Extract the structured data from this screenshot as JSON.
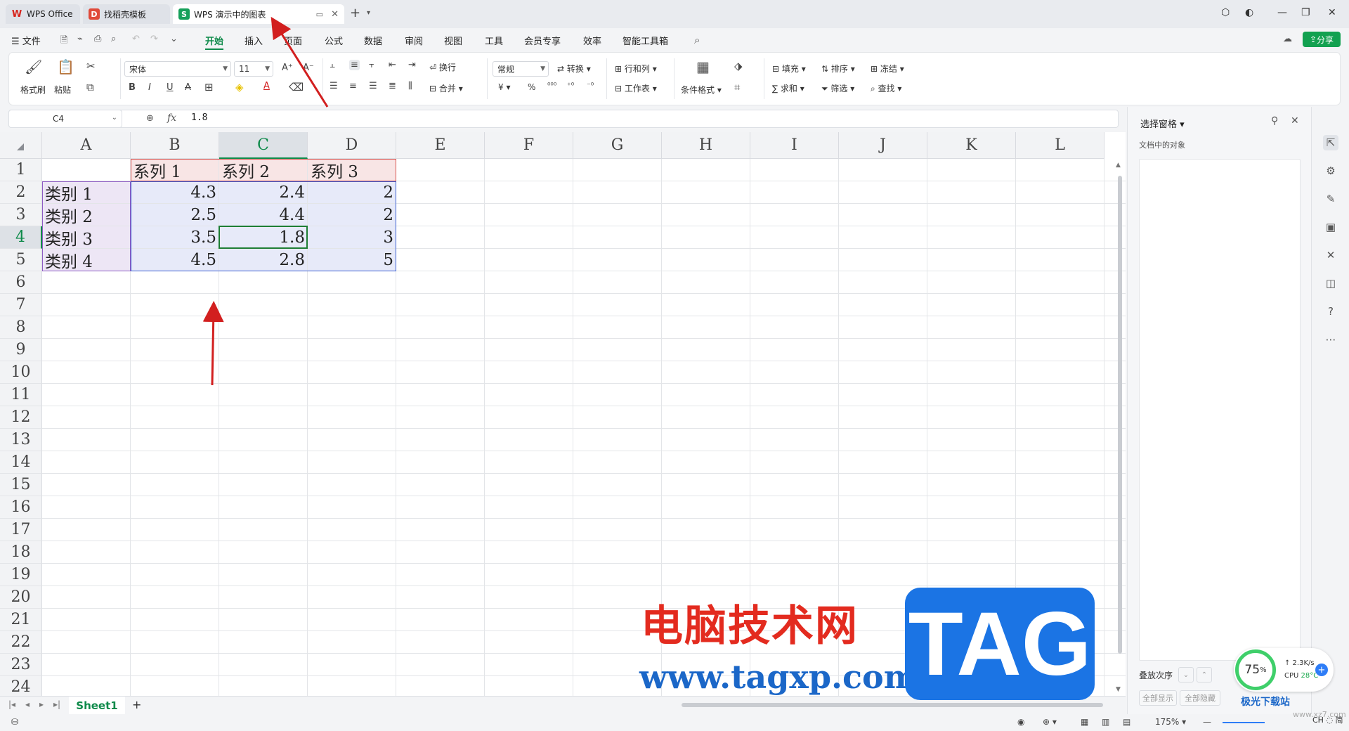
{
  "tabs": [
    {
      "label": "WPS Office"
    },
    {
      "label": "找稻壳模板"
    },
    {
      "label": "WPS 演示中的图表"
    }
  ],
  "menu": {
    "file": "文件",
    "items": [
      "开始",
      "插入",
      "页面",
      "公式",
      "数据",
      "审阅",
      "视图",
      "工具",
      "会员专享",
      "效率",
      "智能工具箱"
    ],
    "share": "分享"
  },
  "ribbon": {
    "format_painter": "格式刷",
    "paste": "粘贴",
    "font_name": "宋体",
    "font_size": "11",
    "wrap": "换行",
    "merge": "合并",
    "number_format": "常规",
    "convert": "转换",
    "row_col": "行和列",
    "worksheet": "工作表",
    "cond_format": "条件格式",
    "fill": "填充",
    "sort": "排序",
    "freeze": "冻结",
    "sum": "求和",
    "filter": "筛选",
    "find": "查找",
    "yen": "¥",
    "percent": "%"
  },
  "formula_bar": {
    "cell_ref": "C4",
    "fx": "fx",
    "value": "1.8"
  },
  "sheet": {
    "columns": [
      "A",
      "B",
      "C",
      "D",
      "E",
      "F",
      "G",
      "H",
      "I",
      "J",
      "K",
      "L"
    ],
    "rows": [
      "1",
      "2",
      "3",
      "4",
      "5",
      "6",
      "7",
      "8",
      "9",
      "10",
      "11",
      "12",
      "13",
      "14",
      "15",
      "16",
      "17",
      "18",
      "19",
      "20",
      "21",
      "22",
      "23",
      "24"
    ],
    "selected_col": "C",
    "selected_row": "4",
    "header_row": [
      "",
      "系列 1",
      "系列 2",
      "系列 3"
    ],
    "data": [
      [
        "类别 1",
        "4.3",
        "2.4",
        "2"
      ],
      [
        "类别 2",
        "2.5",
        "4.4",
        "2"
      ],
      [
        "类别 3",
        "3.5",
        "1.8",
        "3"
      ],
      [
        "类别 4",
        "4.5",
        "2.8",
        "5"
      ]
    ],
    "sheet_tab": "Sheet1"
  },
  "right_pane": {
    "title": "选择窗格",
    "subtitle": "文档中的对象",
    "order_label": "叠放次序",
    "show_all": "全部显示",
    "hide_all": "全部隐藏"
  },
  "status": {
    "zoom": "175%"
  },
  "widget": {
    "percent": "75",
    "percent_unit": "%",
    "speed": "↑ 2.3K/s",
    "cpu_label": "CPU",
    "cpu_temp": "28°C"
  },
  "watermark": {
    "cn": "电脑技术网",
    "url": "www.tagxp.com",
    "tag": "TAG",
    "corner": "极光下载站",
    "corner2": "www.xz7.com",
    "ch": "CH ◌ 简"
  },
  "colors": {
    "accent": "#0e8a4a",
    "annotation_arrow": "#d21f1f"
  }
}
